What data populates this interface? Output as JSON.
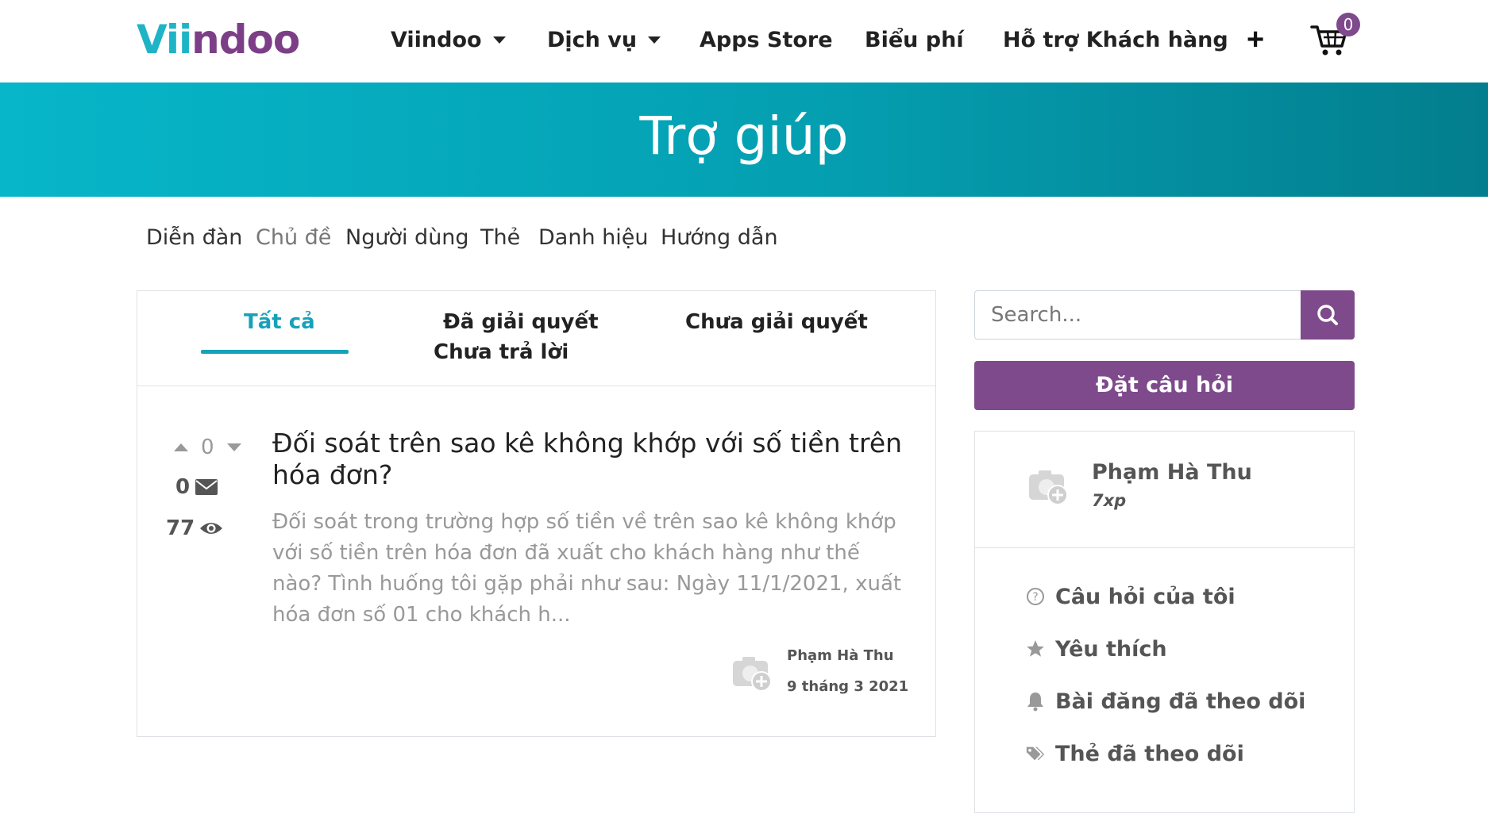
{
  "header": {
    "logo": "Viindoo",
    "nav": [
      "Viindoo",
      "Dịch vụ",
      "Apps Store",
      "Biểu phí",
      "Hỗ trợ Khách hàng"
    ],
    "plus_label": "+",
    "cart_count": "0"
  },
  "banner": {
    "title": "Trợ giúp"
  },
  "subnav": [
    "Diễn đàn",
    "Chủ đề",
    "Người dùng",
    "Thẻ",
    "Danh hiệu",
    "Hướng dẫn"
  ],
  "tabs": {
    "all": "Tất cả",
    "solved": "Đã giải quyết",
    "unsolved": "Chưa giải quyết",
    "unanswered": "Chưa trả lời"
  },
  "post": {
    "votes": "0",
    "answers": "0",
    "views": "77",
    "title": "Đối soát trên sao kê không khớp với số tiền trên hóa đơn?",
    "excerpt": "Đối soát trong trường hợp số tiền về trên sao kê không khớp với số tiền trên hóa đơn đã xuất cho khách hàng như thế nào? Tình huống tôi gặp phải như sau: Ngày 11/1/2021, xuất hóa đơn số 01 cho khách h...",
    "author": "Phạm Hà Thu",
    "date": "9 tháng 3 2021"
  },
  "sidebar": {
    "search_placeholder": "Search...",
    "ask_button": "Đặt câu hỏi",
    "user_name": "Phạm Hà Thu",
    "user_xp": "7xp",
    "menu": [
      "Câu hỏi của tôi",
      "Yêu thích",
      "Bài đăng đã theo dõi",
      "Thẻ đã theo dõi"
    ]
  },
  "colors": {
    "teal": "#17a2b8",
    "purple": "#7e4a8c",
    "banner_start": "#07b6c9",
    "banner_end": "#037e8e"
  }
}
